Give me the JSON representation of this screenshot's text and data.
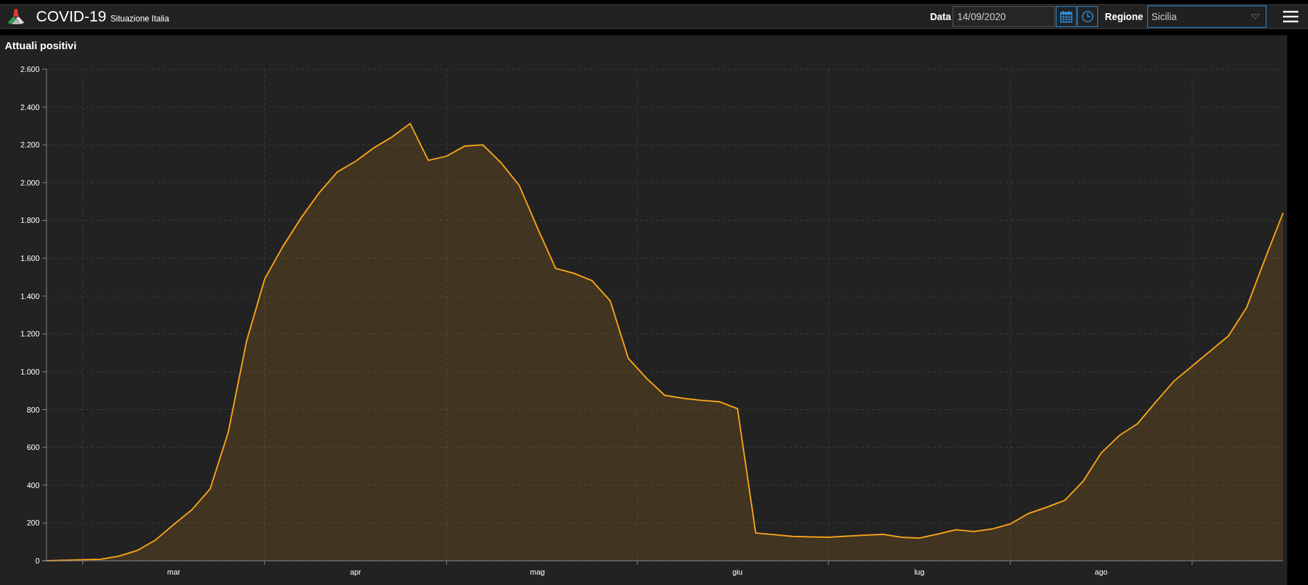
{
  "header": {
    "title": "COVID-19",
    "subtitle": "Situazione Italia",
    "date_label": "Data",
    "date_value": "14/09/2020",
    "region_label": "Regione",
    "region_value": "Sicilia"
  },
  "panel": {
    "chart_data": {
      "type": "area",
      "title": "Attuali positivi",
      "categories": [
        null,
        null,
        null,
        null,
        null,
        null,
        null,
        "mar",
        null,
        null,
        null,
        null,
        null,
        null,
        null,
        null,
        null,
        "apr",
        null,
        null,
        null,
        null,
        null,
        null,
        null,
        null,
        null,
        "mag",
        null,
        null,
        null,
        null,
        null,
        null,
        null,
        null,
        null,
        null,
        "giu",
        null,
        null,
        null,
        null,
        null,
        null,
        null,
        null,
        null,
        "lug",
        null,
        null,
        null,
        null,
        null,
        null,
        null,
        null,
        null,
        "ago",
        null,
        null,
        null,
        null,
        null,
        null,
        null,
        null,
        null,
        null
      ],
      "series": [
        {
          "color": "#f5a31a",
          "values": [
            0,
            3,
            5,
            8,
            25,
            55,
            110,
            192,
            270,
            380,
            680,
            1160,
            1490,
            1662,
            1813,
            1947,
            2057,
            2113,
            2184,
            2242,
            2313,
            2118,
            2140,
            2193,
            2200,
            2105,
            1985,
            1760,
            1547,
            1521,
            1482,
            1375,
            1070,
            965,
            875,
            860,
            849,
            841,
            805,
            147,
            138,
            129,
            126,
            125,
            130,
            135,
            140,
            124,
            120,
            141,
            164,
            155,
            168,
            195,
            250,
            283,
            320,
            420,
            570,
            663,
            725,
            840,
            950,
            1030,
            1110,
            1190,
            1340,
            1595,
            1840
          ]
        }
      ],
      "grid": true,
      "ylim": [
        0,
        2600
      ],
      "yticks": [
        {
          "value": 0,
          "label": "0"
        },
        {
          "value": 200,
          "label": "200"
        },
        {
          "value": 400,
          "label": "400"
        },
        {
          "value": 600,
          "label": "600"
        },
        {
          "value": 800,
          "label": "800"
        },
        {
          "value": 1000,
          "label": "1.000"
        },
        {
          "value": 1200,
          "label": "1.200"
        },
        {
          "value": 1400,
          "label": "1.400"
        },
        {
          "value": 1600,
          "label": "1.600"
        },
        {
          "value": 1800,
          "label": "1.800"
        },
        {
          "value": 2000,
          "label": "2.000"
        },
        {
          "value": 2200,
          "label": "2.200"
        },
        {
          "value": 2400,
          "label": "2.400"
        },
        {
          "value": 2600,
          "label": "2.600"
        }
      ]
    }
  }
}
